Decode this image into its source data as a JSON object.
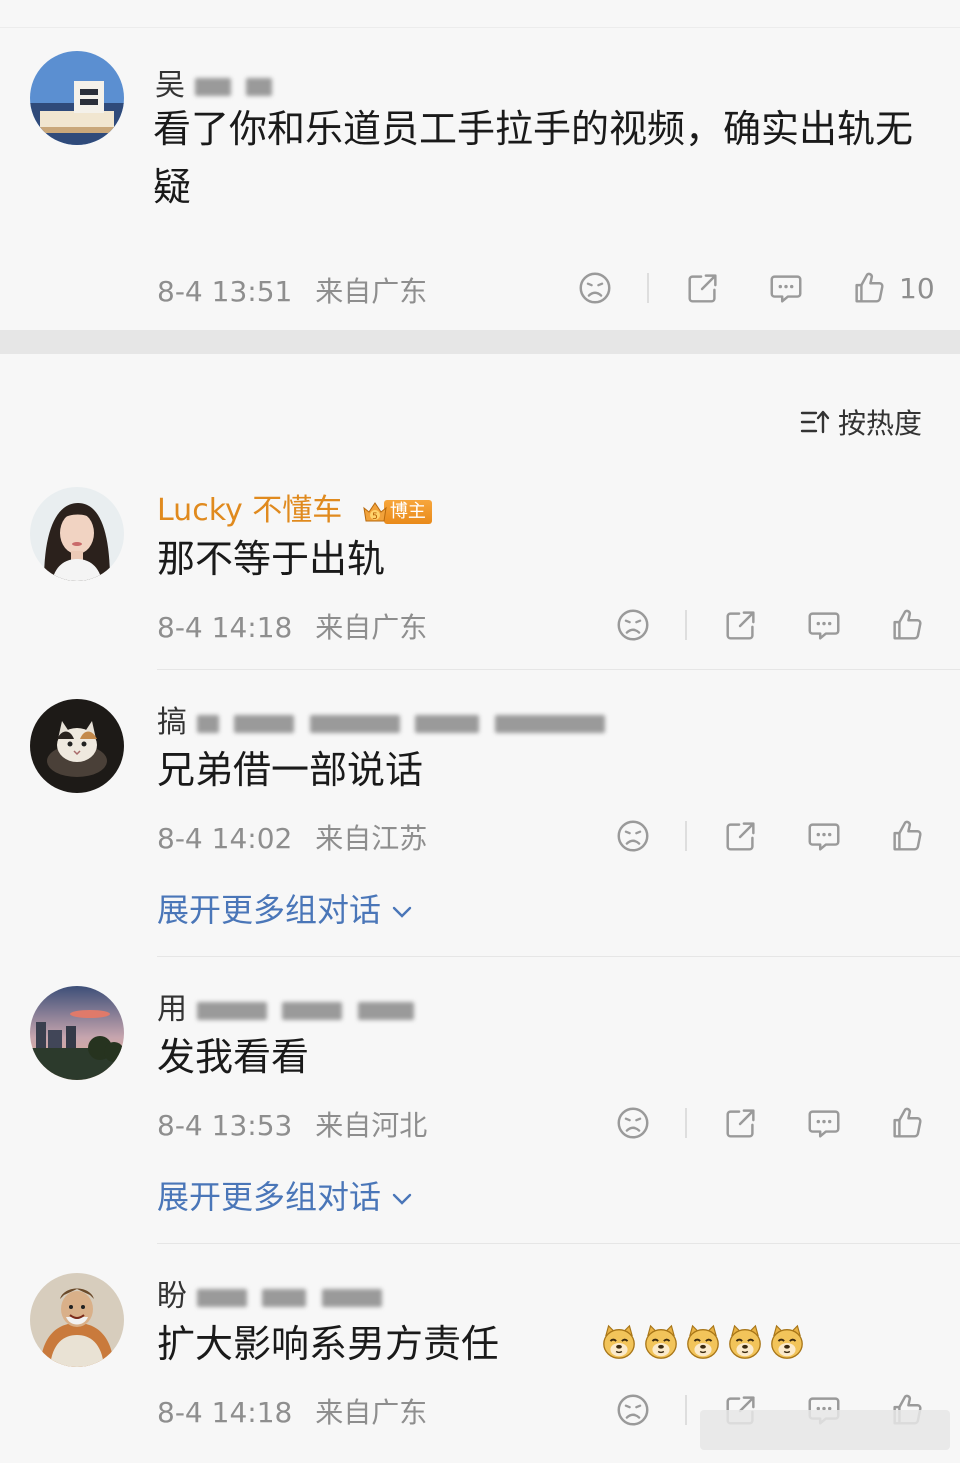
{
  "post": {
    "username_visible": "吴",
    "text": "看了你和乐道员工手拉手的视频，确实出轨无疑",
    "time": "8-4 13:51",
    "location": "来自广东",
    "like_count": "10"
  },
  "sort": {
    "label": "按热度"
  },
  "comments": [
    {
      "username": "Lucky 不懂车",
      "badge": "博主",
      "badge_level": "5",
      "text": "那不等于出轨",
      "time": "8-4 14:18",
      "location": "来自广东"
    },
    {
      "username_visible": "搞",
      "text": "兄弟借一部说话",
      "time": "8-4 14:02",
      "location": "来自江苏",
      "expand": "展开更多组对话"
    },
    {
      "username_visible": "用",
      "text": "发我看看",
      "time": "8-4 13:53",
      "location": "来自河北",
      "expand": "展开更多组对话"
    },
    {
      "username_visible": "盼",
      "text": "扩大影响系男方责任",
      "time": "8-4 14:18",
      "location": "来自广东",
      "emoji": [
        "doge",
        "doge",
        "doge",
        "doge",
        "doge"
      ]
    }
  ],
  "colors": {
    "accent_link": "#4a76b8",
    "vip_gold": "#e08a1e",
    "meta_gray": "#8e8e8e"
  }
}
